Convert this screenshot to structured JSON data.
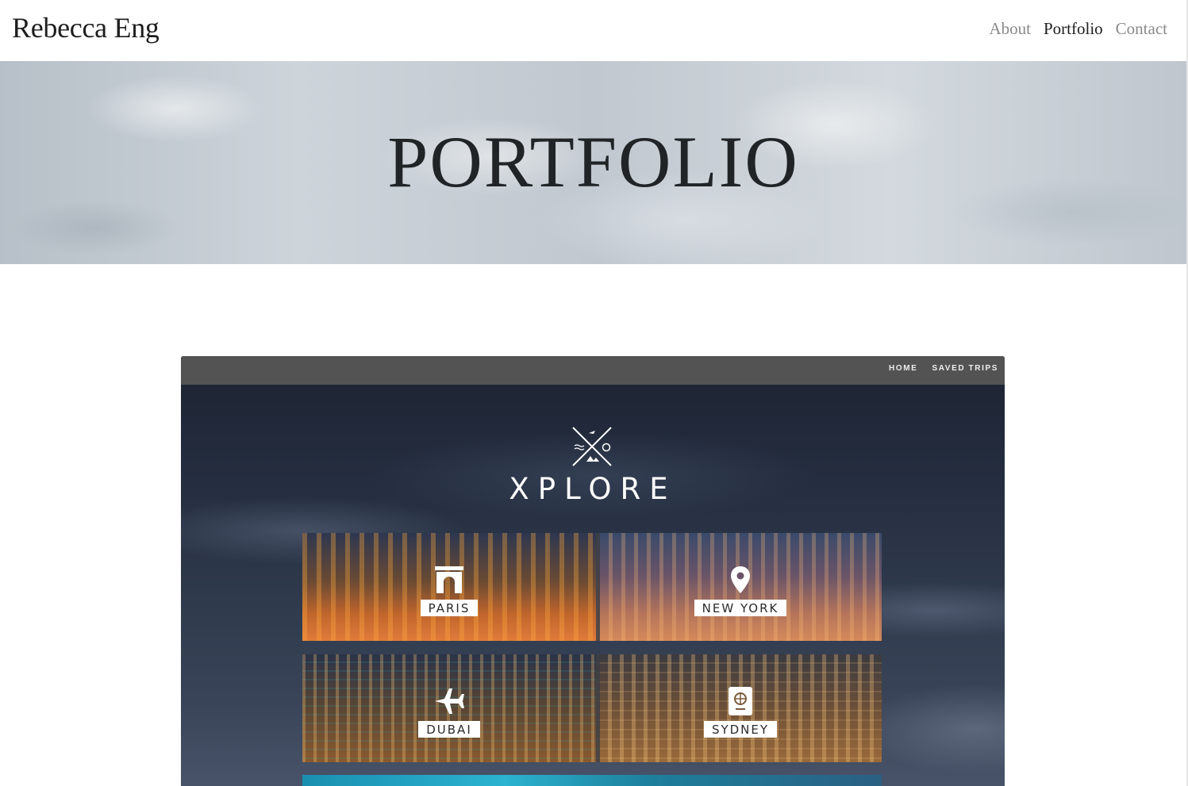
{
  "header": {
    "title": "Rebecca Eng",
    "nav": [
      {
        "label": "About",
        "active": false
      },
      {
        "label": "Portfolio",
        "active": true
      },
      {
        "label": "Contact",
        "active": false
      }
    ]
  },
  "hero": {
    "title": "PORTFOLIO"
  },
  "project": {
    "nav": [
      "HOME",
      "SAVED TRIPS"
    ],
    "brand": "XPLORE",
    "destinations": [
      {
        "label": "PARIS",
        "icon": "arch-icon"
      },
      {
        "label": "NEW YORK",
        "icon": "map-pin-icon"
      },
      {
        "label": "DUBAI",
        "icon": "airplane-icon"
      },
      {
        "label": "SYDNEY",
        "icon": "passport-icon"
      }
    ]
  }
}
